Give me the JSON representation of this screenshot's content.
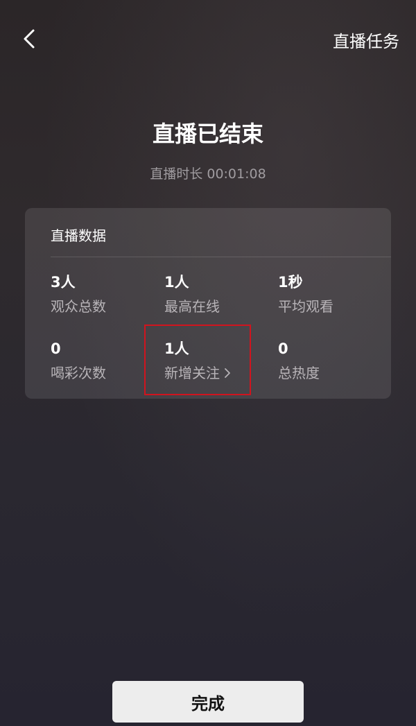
{
  "header": {
    "back_icon": "chevron-left-icon",
    "task_label": "直播任务"
  },
  "summary": {
    "title": "直播已结束",
    "duration_label": "直播时长 00:01:08"
  },
  "stats_card": {
    "title": "直播数据",
    "items": [
      {
        "value": "3人",
        "label": "观众总数"
      },
      {
        "value": "1人",
        "label": "最高在线"
      },
      {
        "value": "1秒",
        "label": "平均观看"
      },
      {
        "value": "0",
        "label": "喝彩次数"
      },
      {
        "value": "1人",
        "label": "新增关注",
        "icon": "chevron-right-icon"
      },
      {
        "value": "0",
        "label": "总热度"
      }
    ]
  },
  "annotation": {
    "highlight_color": "#d1141e"
  },
  "footer": {
    "done_label": "完成"
  }
}
